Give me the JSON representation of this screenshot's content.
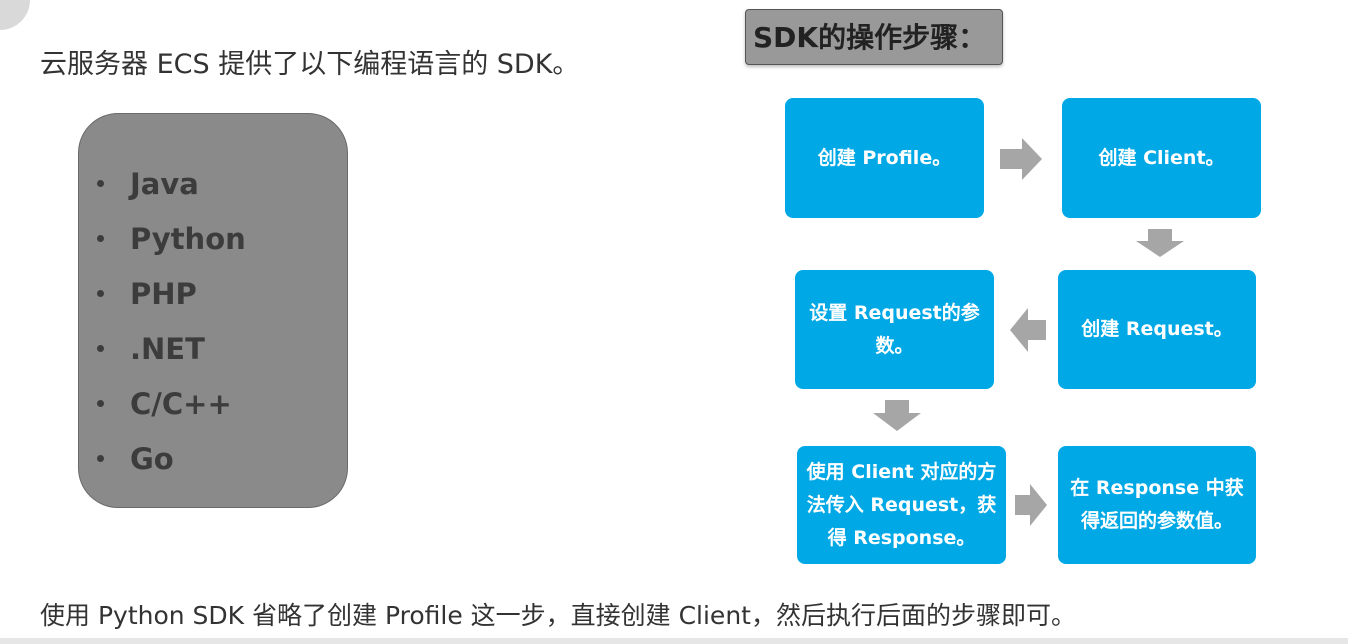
{
  "intro_text": "云服务器 ECS 提供了以下编程语言的 SDK。",
  "languages": [
    "Java",
    "Python",
    "PHP",
    ".NET",
    "C/C++",
    "Go"
  ],
  "steps_title": "SDK的操作步骤：",
  "steps": {
    "create_profile": "创建 Profile。",
    "create_client": "创建 Client。",
    "create_request": "创建 Request。",
    "set_request_params": "设置 Request的参数。",
    "call_method": "使用 Client 对应的方法传入 Request，获得 Response。",
    "get_response_values": "在 Response 中获得返回的参数值。"
  },
  "bottom_note": "使用 Python SDK 省略了创建 Profile 这一步，直接创建 Client，然后执行后面的步骤即可。",
  "colors": {
    "step_fill": "#00a8e6",
    "arrow_fill": "#a6a6a6",
    "language_box": "#8a8a8a",
    "title_box": "#999999"
  }
}
